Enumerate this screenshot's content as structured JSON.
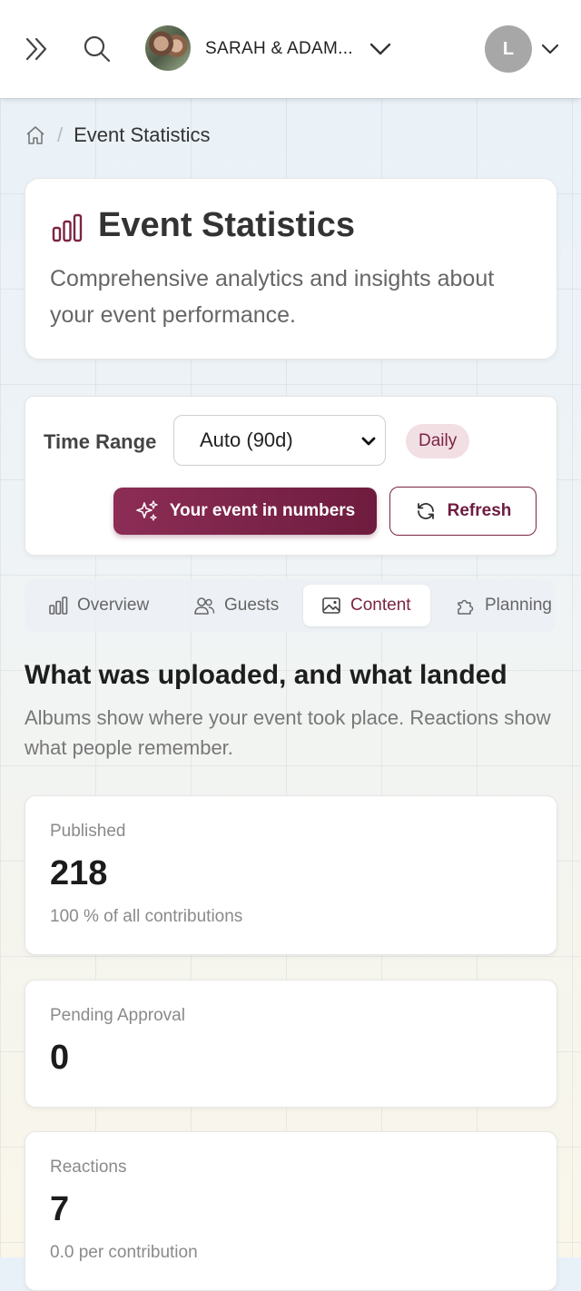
{
  "topbar": {
    "event_name": "SARAH & ADAM...",
    "avatar_initial": "L"
  },
  "breadcrumb": {
    "current": "Event Statistics"
  },
  "header": {
    "title": "Event Statistics",
    "subtitle": "Comprehensive analytics and insights about your event performance."
  },
  "controls": {
    "time_range_label": "Time Range",
    "time_range_value": "Auto (90d)",
    "granularity_badge": "Daily",
    "primary_button": "Your event in numbers",
    "refresh_button": "Refresh"
  },
  "tabs": [
    {
      "label": "Overview",
      "icon": "bar-chart-icon"
    },
    {
      "label": "Guests",
      "icon": "users-icon"
    },
    {
      "label": "Content",
      "icon": "image-icon",
      "active": true
    },
    {
      "label": "Planning",
      "icon": "puzzle-icon"
    }
  ],
  "section": {
    "title": "What was uploaded, and what landed",
    "subtitle": "Albums show where your event took place. Reactions show what people remember."
  },
  "stats": [
    {
      "label": "Published",
      "value": "218",
      "note": "100 % of all contributions"
    },
    {
      "label": "Pending Approval",
      "value": "0"
    },
    {
      "label": "Reactions",
      "value": "7",
      "note": "0.0 per contribution"
    }
  ],
  "colors": {
    "accent": "#7b2443",
    "accent_light": "#f1dfe4"
  }
}
